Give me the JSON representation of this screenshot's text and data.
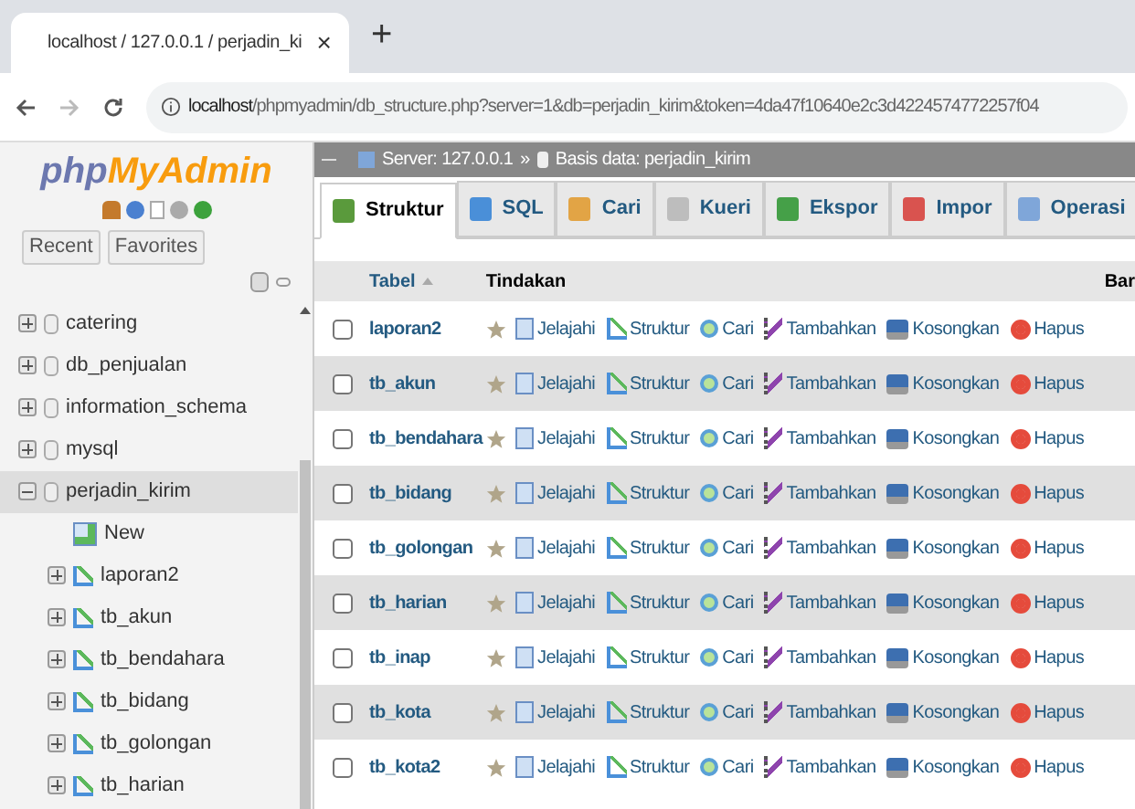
{
  "browser": {
    "tab_title": "localhost / 127.0.0.1 / perjadin_ki",
    "new_tab": "+",
    "close": "×",
    "url_host": "localhost",
    "url_path": "/phpmyadmin/db_structure.php?server=1&db=perjadin_kirim&token=4da47f10640e2c3d4224574772257f04"
  },
  "sidebar": {
    "logo_php": "php",
    "logo_myadmin": "MyAdmin",
    "tabs": [
      {
        "label": "Recent"
      },
      {
        "label": "Favorites"
      }
    ],
    "tree": [
      {
        "label": "catering",
        "kind": "database",
        "expanded": false,
        "selected": false
      },
      {
        "label": "db_penjualan",
        "kind": "database",
        "expanded": false,
        "selected": false
      },
      {
        "label": "information_schema",
        "kind": "database",
        "expanded": false,
        "selected": false
      },
      {
        "label": "mysql",
        "kind": "database",
        "expanded": false,
        "selected": false
      },
      {
        "label": "perjadin_kirim",
        "kind": "database",
        "expanded": true,
        "selected": true,
        "children": [
          {
            "label": "New",
            "kind": "new"
          },
          {
            "label": "laporan2",
            "kind": "table"
          },
          {
            "label": "tb_akun",
            "kind": "table"
          },
          {
            "label": "tb_bendahara",
            "kind": "table"
          },
          {
            "label": "tb_bidang",
            "kind": "table"
          },
          {
            "label": "tb_golongan",
            "kind": "table"
          },
          {
            "label": "tb_harian",
            "kind": "table"
          }
        ]
      }
    ]
  },
  "breadcrumb": {
    "server": "Server: 127.0.0.1",
    "separator": "»",
    "database": "Basis data: perjadin_kirim"
  },
  "tabs": [
    {
      "label": "Struktur",
      "selected": true
    },
    {
      "label": "SQL",
      "selected": false
    },
    {
      "label": "Cari",
      "selected": false
    },
    {
      "label": "Kueri",
      "selected": false
    },
    {
      "label": "Ekspor",
      "selected": false
    },
    {
      "label": "Impor",
      "selected": false
    },
    {
      "label": "Operasi",
      "selected": false
    }
  ],
  "table": {
    "columns": [
      "Tabel",
      "Tindakan",
      "Bar"
    ],
    "rows": [
      {
        "name": "laporan2",
        "checked": false,
        "actions": [
          "Jelajahi",
          "Struktur",
          "Cari",
          "Tambahkan",
          "Kosongkan",
          "Hapus"
        ]
      },
      {
        "name": "tb_akun",
        "checked": false,
        "actions": [
          "Jelajahi",
          "Struktur",
          "Cari",
          "Tambahkan",
          "Kosongkan",
          "Hapus"
        ]
      },
      {
        "name": "tb_bendahara",
        "checked": false,
        "actions": [
          "Jelajahi",
          "Struktur",
          "Cari",
          "Tambahkan",
          "Kosongkan",
          "Hapus"
        ]
      },
      {
        "name": "tb_bidang",
        "checked": false,
        "actions": [
          "Jelajahi",
          "Struktur",
          "Cari",
          "Tambahkan",
          "Kosongkan",
          "Hapus"
        ]
      },
      {
        "name": "tb_golongan",
        "checked": false,
        "actions": [
          "Jelajahi",
          "Struktur",
          "Cari",
          "Tambahkan",
          "Kosongkan",
          "Hapus"
        ]
      },
      {
        "name": "tb_harian",
        "checked": false,
        "actions": [
          "Jelajahi",
          "Struktur",
          "Cari",
          "Tambahkan",
          "Kosongkan",
          "Hapus"
        ]
      },
      {
        "name": "tb_inap",
        "checked": false,
        "actions": [
          "Jelajahi",
          "Struktur",
          "Cari",
          "Tambahkan",
          "Kosongkan",
          "Hapus"
        ]
      },
      {
        "name": "tb_kota",
        "checked": false,
        "actions": [
          "Jelajahi",
          "Struktur",
          "Cari",
          "Tambahkan",
          "Kosongkan",
          "Hapus"
        ]
      },
      {
        "name": "tb_kota2",
        "checked": false,
        "actions": [
          "Jelajahi",
          "Struktur",
          "Cari",
          "Tambahkan",
          "Kosongkan",
          "Hapus"
        ]
      }
    ]
  }
}
